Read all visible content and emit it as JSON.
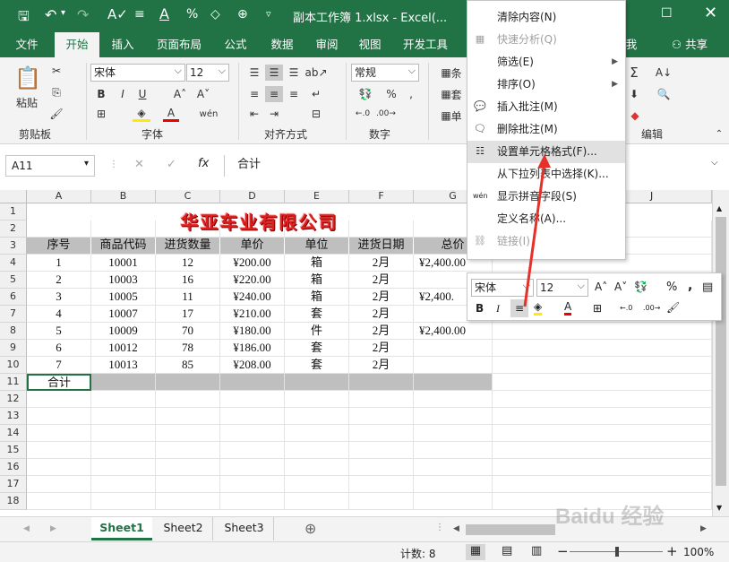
{
  "titlebar": {
    "filename": "副本工作簿 1.xlsx - Excel(..."
  },
  "tabs": [
    "文件",
    "开始",
    "插入",
    "页面布局",
    "公式",
    "数据",
    "审阅",
    "视图",
    "开发工具",
    "我",
    "共享"
  ],
  "ribbon": {
    "groups": [
      "剪贴板",
      "字体",
      "对齐方式",
      "数字",
      "编辑"
    ],
    "paste_label": "粘贴",
    "font_name": "宋体",
    "font_size": "12",
    "number_format": "常规",
    "cond_labels": [
      "条",
      "套",
      "单"
    ]
  },
  "formula_bar": {
    "name_box": "A11",
    "content": "合计",
    "fx": "fx"
  },
  "columns": [
    "A",
    "B",
    "C",
    "D",
    "E",
    "F",
    "G",
    "J"
  ],
  "rows": [
    "1",
    "2",
    "3",
    "4",
    "5",
    "6",
    "7",
    "8",
    "9",
    "10",
    "11",
    "12",
    "13",
    "14",
    "15",
    "16",
    "17",
    "18"
  ],
  "sheet": {
    "title": "华亚车业有限公司",
    "headers": [
      "序号",
      "商品代码",
      "进货数量",
      "单价",
      "单位",
      "进货日期",
      "总价"
    ],
    "data": [
      [
        "1",
        "10001",
        "12",
        "¥200.00",
        "箱",
        "2月",
        "¥2,400.00"
      ],
      [
        "2",
        "10003",
        "16",
        "¥220.00",
        "箱",
        "2月",
        ""
      ],
      [
        "3",
        "10005",
        "11",
        "¥240.00",
        "箱",
        "2月",
        "¥2,400."
      ],
      [
        "4",
        "10007",
        "17",
        "¥210.00",
        "套",
        "2月",
        ""
      ],
      [
        "5",
        "10009",
        "70",
        "¥180.00",
        "件",
        "2月",
        "¥2,400.00"
      ],
      [
        "6",
        "10012",
        "78",
        "¥186.00",
        "套",
        "2月",
        ""
      ],
      [
        "7",
        "10013",
        "85",
        "¥208.00",
        "套",
        "2月",
        ""
      ]
    ],
    "total_label": "合计"
  },
  "context_menu": [
    {
      "label": "清除内容(N)",
      "disabled": false,
      "icon": ""
    },
    {
      "label": "快速分析(Q)",
      "disabled": true,
      "icon": "quick-analysis-icon"
    },
    {
      "label": "筛选(E)",
      "disabled": false,
      "icon": "",
      "sub": true
    },
    {
      "label": "排序(O)",
      "disabled": false,
      "icon": "",
      "sub": true
    },
    {
      "label": "插入批注(M)",
      "disabled": false,
      "icon": "insert-comment-icon"
    },
    {
      "label": "删除批注(M)",
      "disabled": false,
      "icon": "delete-comment-icon"
    },
    {
      "label": "设置单元格格式(F)...",
      "disabled": false,
      "icon": "format-cells-icon",
      "highlight": true
    },
    {
      "label": "从下拉列表中选择(K)...",
      "disabled": false,
      "icon": ""
    },
    {
      "label": "显示拼音字段(S)",
      "disabled": false,
      "icon": "phonetic-icon"
    },
    {
      "label": "定义名称(A)...",
      "disabled": false,
      "icon": ""
    },
    {
      "label": "链接(I)",
      "disabled": true,
      "icon": "link-icon"
    }
  ],
  "mini_toolbar": {
    "font_name": "宋体",
    "font_size": "12"
  },
  "sheet_tabs": [
    "Sheet1",
    "Sheet2",
    "Sheet3"
  ],
  "status": {
    "count": "计数: 8",
    "zoom": "100%"
  },
  "watermark": "Baidu 经验"
}
